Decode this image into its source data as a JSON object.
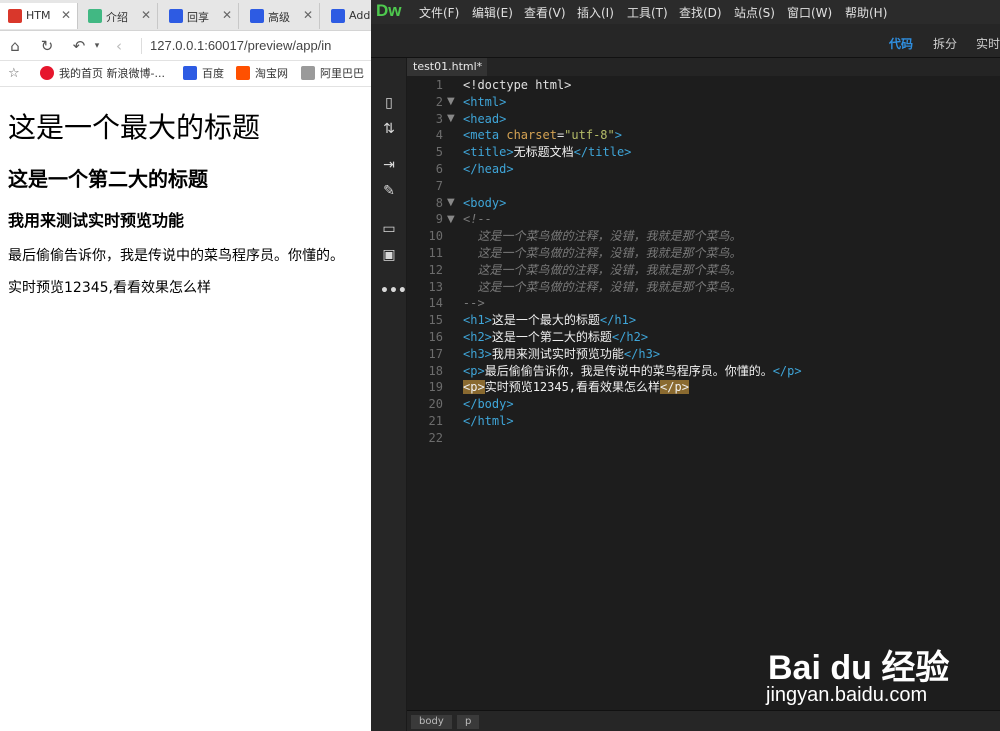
{
  "browser": {
    "tabs": [
      {
        "label": "HTM",
        "icon": "html-icon",
        "color": "#d9372b"
      },
      {
        "label": "介绍",
        "icon": "vue-icon",
        "color": "#41b883"
      },
      {
        "label": "回享",
        "icon": "baidu-paw-icon",
        "color": "#2d5be3"
      },
      {
        "label": "高级",
        "icon": "baidu-paw-icon",
        "color": "#2d5be3"
      },
      {
        "label": "Add",
        "icon": "baidu-paw-icon",
        "color": "#2d5be3"
      }
    ],
    "url": "127.0.0.1:60017/preview/app/in",
    "bookmarks": [
      {
        "label": "我的首页 新浪微博-...",
        "icon": "weibo-icon",
        "color": "#e6162d"
      },
      {
        "label": "百度",
        "icon": "baidu-icon",
        "color": "#2d5be3"
      },
      {
        "label": "淘宝网",
        "icon": "taobao-icon",
        "color": "#ff5000"
      },
      {
        "label": "阿里巴巴",
        "icon": "folder-icon",
        "color": "#9a9a9a"
      }
    ],
    "page": {
      "h1": "这是一个最大的标题",
      "h2": "这是一个第二大的标题",
      "h3": "我用来测试实时预览功能",
      "p1": "最后偷偷告诉你，我是传说中的菜鸟程序员。你懂的。",
      "p2": "实时预览12345,看看效果怎么样"
    }
  },
  "dw": {
    "logo": "Dw",
    "menus": [
      "文件(F)",
      "编辑(E)",
      "查看(V)",
      "插入(I)",
      "工具(T)",
      "查找(D)",
      "站点(S)",
      "窗口(W)",
      "帮助(H)"
    ],
    "views": {
      "code": "代码",
      "split": "拆分",
      "live": "实时"
    },
    "doc_tab": "test01.html*",
    "status_crumbs": [
      "body",
      "p"
    ]
  },
  "watermark": {
    "brand": "Bai du 经验",
    "url": "jingyan.baidu.com"
  },
  "colors": {
    "dw_green": "#4ec94e",
    "code_tag": "#3fa5d8",
    "code_attr": "#d4a253",
    "code_string": "#b5bd68",
    "active_view": "#2f8fe0",
    "highlight": "#8a6a30"
  }
}
